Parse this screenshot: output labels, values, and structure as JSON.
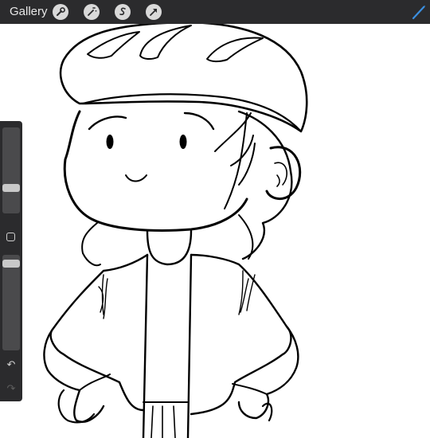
{
  "toolbar": {
    "gallery_label": "Gallery",
    "icons": [
      "wrench-icon",
      "magic-wand-icon",
      "selection-icon",
      "move-arrow-icon"
    ],
    "active_tool": "brush-icon",
    "accent_color": "#3b8fe0"
  },
  "sidebar": {
    "brush_size_level": 0.28,
    "opacity_level": 0.95,
    "undo_glyph": "↶",
    "redo_glyph": "↷"
  },
  "canvas": {
    "subject": "cartoon-character-line-art"
  }
}
